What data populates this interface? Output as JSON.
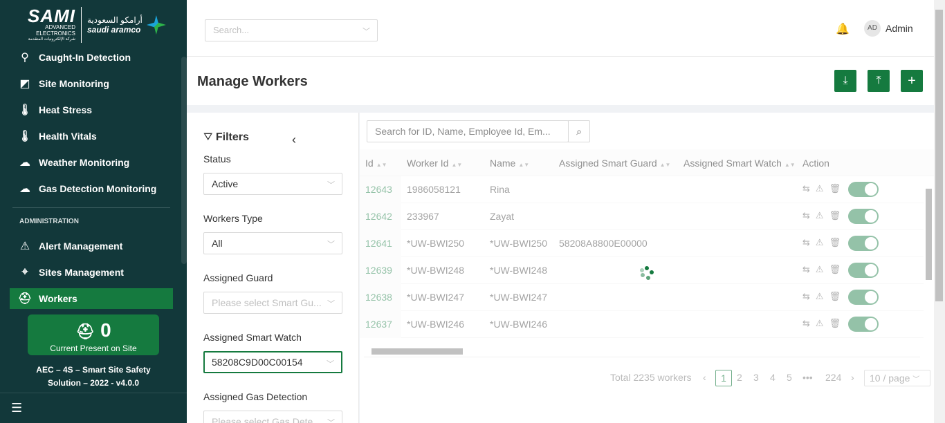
{
  "logo": {
    "brand": "SAMI",
    "sub1": "ADVANCED",
    "sub2": "ELECTRONICS",
    "sub3": "شركة الإلكترونيات المتقدمة",
    "partner_ar": "أرامكو السعودية",
    "partner": "saudi aramco"
  },
  "sidebar": {
    "items": [
      {
        "label": "Caught-In Detection",
        "icon": "hook-icon"
      },
      {
        "label": "Site Monitoring",
        "icon": "cctv-camera-icon"
      },
      {
        "label": "Heat Stress",
        "icon": "thermometer-icon"
      },
      {
        "label": "Health Vitals",
        "icon": "thermometer-icon"
      },
      {
        "label": "Weather Monitoring",
        "icon": "weather-icon"
      },
      {
        "label": "Gas Detection Monitoring",
        "icon": "gas-cloud-icon"
      }
    ],
    "admin_heading": "ADMINISTRATION",
    "admin_items": [
      {
        "label": "Alert Management",
        "icon": "warning-icon"
      },
      {
        "label": "Sites Management",
        "icon": "map-pin-icon"
      },
      {
        "label": "Workers",
        "icon": "worker-helmet-icon",
        "active": true
      }
    ],
    "present_count": "0",
    "present_label": "Current Present on Site",
    "version_line1": "AEC – 4S – Smart Site Safety",
    "version_line2": "Solution – 2022 - v4.0.0"
  },
  "header": {
    "search_placeholder": "Search...",
    "avatar": "AD",
    "user": "Admin"
  },
  "page": {
    "title": "Manage Workers"
  },
  "filters": {
    "title": "Filters",
    "status_label": "Status",
    "status_value": "Active",
    "type_label": "Workers Type",
    "type_value": "All",
    "guard_label": "Assigned Guard",
    "guard_placeholder": "Please select Smart Gu...",
    "watch_label": "Assigned Smart Watch",
    "watch_value": "58208C9D00C00154",
    "gas_label": "Assigned Gas Detection",
    "gas_placeholder": "Please select Gas Dete..."
  },
  "table": {
    "search_placeholder": "Search for ID, Name, Employee Id, Em...",
    "columns": [
      "Id",
      "Worker Id",
      "Name",
      "Assigned Smart Guard",
      "Assigned Smart Watch",
      "Action"
    ],
    "rows": [
      {
        "id": "12643",
        "worker_id": "1986058121",
        "name": "Rina",
        "guard": "",
        "watch": ""
      },
      {
        "id": "12642",
        "worker_id": "233967",
        "name": "Zayat",
        "guard": "",
        "watch": ""
      },
      {
        "id": "12641",
        "worker_id": "*UW-BWI250",
        "name": "*UW-BWI250",
        "guard": "58208A8800E00000",
        "watch": ""
      },
      {
        "id": "12639",
        "worker_id": "*UW-BWI248",
        "name": "*UW-BWI248",
        "guard": "",
        "watch": ""
      },
      {
        "id": "12638",
        "worker_id": "*UW-BWI247",
        "name": "*UW-BWI247",
        "guard": "",
        "watch": ""
      },
      {
        "id": "12637",
        "worker_id": "*UW-BWI246",
        "name": "*UW-BWI246",
        "guard": "",
        "watch": ""
      }
    ]
  },
  "pagination": {
    "total": "Total 2235 workers",
    "pages": [
      "1",
      "2",
      "3",
      "4",
      "5",
      "•••",
      "224"
    ],
    "current": "1",
    "page_size": "10 / page"
  },
  "colors": {
    "primary": "#157a3f",
    "sidebar": "#12383a"
  }
}
